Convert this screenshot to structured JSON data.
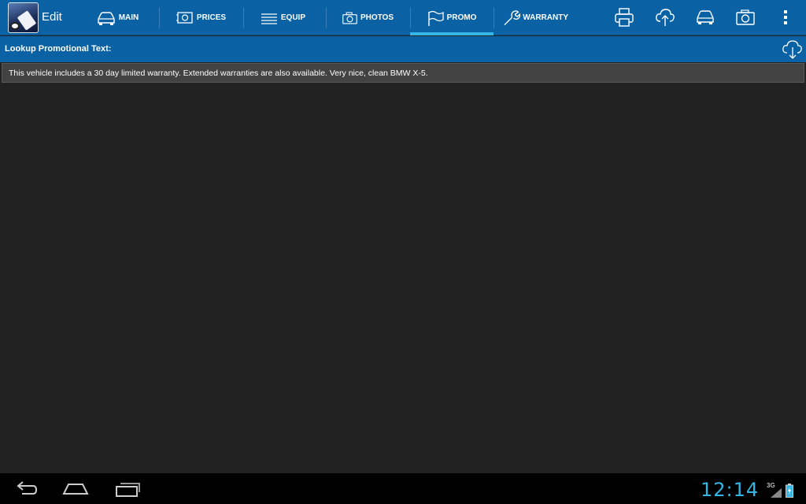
{
  "app": {
    "title": "Edit"
  },
  "tabs": [
    {
      "label": "MAIN",
      "icon": "car-icon"
    },
    {
      "label": "PRICES",
      "icon": "price-tag-icon"
    },
    {
      "label": "EQUIP",
      "icon": "list-icon"
    },
    {
      "label": "PHOTOS",
      "icon": "camera-icon"
    },
    {
      "label": "PROMO",
      "icon": "flag-icon",
      "selected": true
    },
    {
      "label": "WARRANTY",
      "icon": "wrench-icon"
    }
  ],
  "actions": [
    "print-icon",
    "cloud-upload-icon",
    "car-icon",
    "camera-icon",
    "overflow-menu-icon"
  ],
  "promo": {
    "lookup_label": "Lookup Promotional Text:",
    "text": "This vehicle includes a 30 day limited warranty. Extended warranties are also available. Very nice, clean BMW X-5."
  },
  "status": {
    "time": "12:14",
    "network": "3G"
  },
  "colors": {
    "actionbar": "#0a62a4",
    "accent": "#33b5e5",
    "background": "#222222"
  }
}
